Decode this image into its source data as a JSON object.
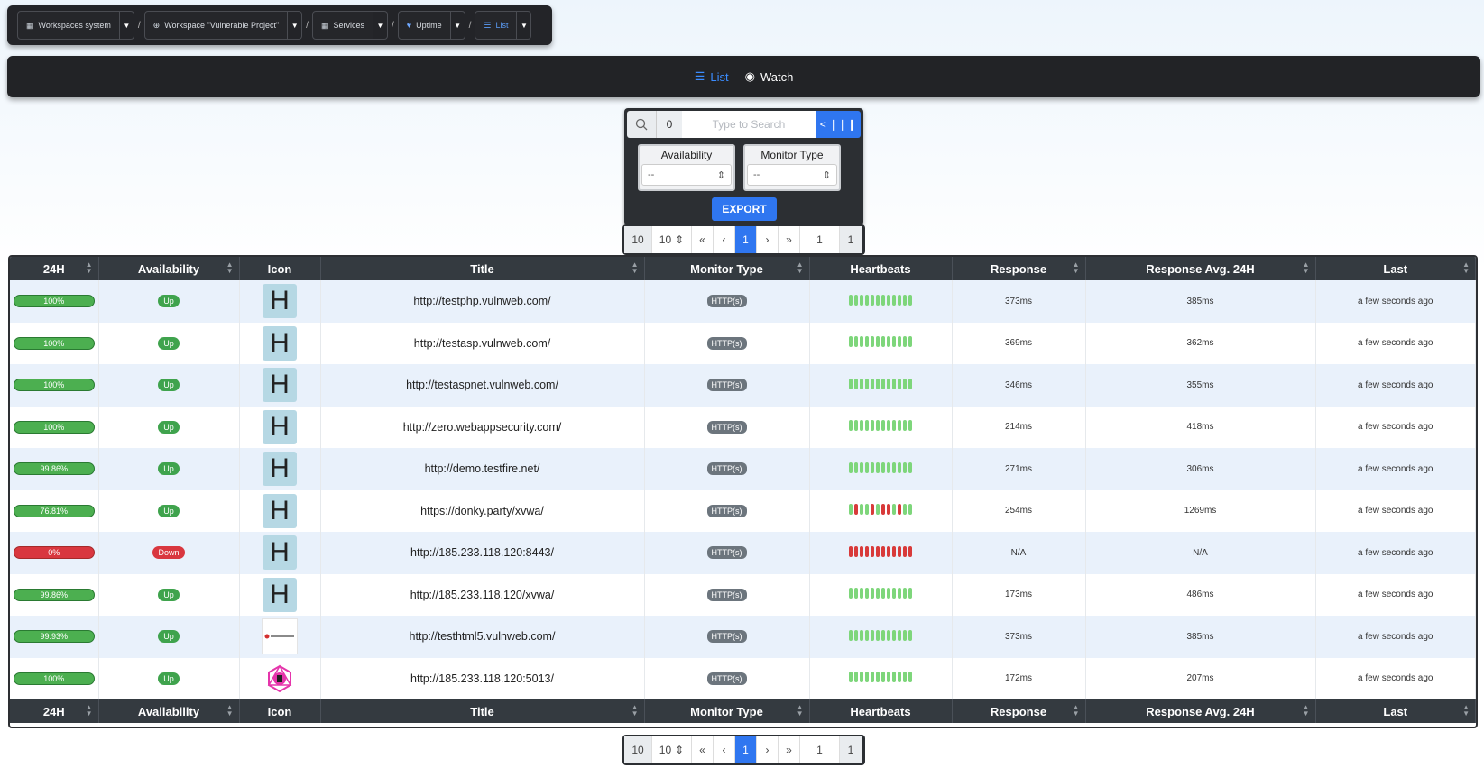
{
  "breadcrumb": {
    "items": [
      {
        "label": "Workspaces system",
        "icon": "grid-icon"
      },
      {
        "label": "Workspace \"Vulnerable Project\"",
        "icon": "circle-arrow-icon"
      },
      {
        "label": "Services",
        "icon": "grid-icon"
      },
      {
        "label": "Uptime",
        "icon": "heart-icon"
      },
      {
        "label": "List",
        "icon": "list-icon"
      }
    ],
    "separator": "/"
  },
  "tabs": [
    {
      "label": "List",
      "active": true
    },
    {
      "label": "Watch",
      "active": false
    }
  ],
  "search": {
    "count": "0",
    "placeholder": "Type to Search",
    "toggle_label": "< ❙❙❙"
  },
  "filters": {
    "availability": {
      "label": "Availability",
      "value": "--"
    },
    "monitor_type": {
      "label": "Monitor Type",
      "value": "--"
    }
  },
  "export_label": "EXPORT",
  "pagination": {
    "page_size_label": "10",
    "page_size_value": "10",
    "first": "«",
    "prev": "‹",
    "current": "1",
    "next": "›",
    "last": "»",
    "goto_value": "1",
    "total_pages": "1"
  },
  "table": {
    "headers": [
      "24H",
      "Availability",
      "Icon",
      "Title",
      "Monitor Type",
      "Heartbeats",
      "Response",
      "Response Avg. 24H",
      "Last"
    ],
    "rows": [
      {
        "h24": "100%",
        "h24_status": "ok",
        "availability": "Up",
        "icon": "H",
        "title": "http://testphp.vulnweb.com/",
        "type": "HTTP(s)",
        "beats": "gggggggggggg",
        "response": "373ms",
        "avg": "385ms",
        "last": "a few seconds ago"
      },
      {
        "h24": "100%",
        "h24_status": "ok",
        "availability": "Up",
        "icon": "H",
        "title": "http://testasp.vulnweb.com/",
        "type": "HTTP(s)",
        "beats": "gggggggggggg",
        "response": "369ms",
        "avg": "362ms",
        "last": "a few seconds ago"
      },
      {
        "h24": "100%",
        "h24_status": "ok",
        "availability": "Up",
        "icon": "H",
        "title": "http://testaspnet.vulnweb.com/",
        "type": "HTTP(s)",
        "beats": "gggggggggggg",
        "response": "346ms",
        "avg": "355ms",
        "last": "a few seconds ago"
      },
      {
        "h24": "100%",
        "h24_status": "ok",
        "availability": "Up",
        "icon": "H",
        "title": "http://zero.webappsecurity.com/",
        "type": "HTTP(s)",
        "beats": "gggggggggggg",
        "response": "214ms",
        "avg": "418ms",
        "last": "a few seconds ago"
      },
      {
        "h24": "99.86%",
        "h24_status": "ok",
        "availability": "Up",
        "icon": "H",
        "title": "http://demo.testfire.net/",
        "type": "HTTP(s)",
        "beats": "gggggggggggg",
        "response": "271ms",
        "avg": "306ms",
        "last": "a few seconds ago"
      },
      {
        "h24": "76.81%",
        "h24_status": "ok",
        "availability": "Up",
        "icon": "H",
        "title": "https://donky.party/xvwa/",
        "type": "HTTP(s)",
        "beats": "grggrgrrgrgg",
        "response": "254ms",
        "avg": "1269ms",
        "last": "a few seconds ago"
      },
      {
        "h24": "0%",
        "h24_status": "bad",
        "availability": "Down",
        "icon": "H",
        "title": "http://185.233.118.120:8443/",
        "type": "HTTP(s)",
        "beats": "rrrrrrrrrrrr",
        "response": "N/A",
        "avg": "N/A",
        "last": "a few seconds ago"
      },
      {
        "h24": "99.86%",
        "h24_status": "ok",
        "availability": "Up",
        "icon": "H",
        "title": "http://185.233.118.120/xvwa/",
        "type": "HTTP(s)",
        "beats": "gggggggggggg",
        "response": "173ms",
        "avg": "486ms",
        "last": "a few seconds ago"
      },
      {
        "h24": "99.93%",
        "h24_status": "ok",
        "availability": "Up",
        "icon": "securitytweets-logo",
        "title": "http://testhtml5.vulnweb.com/",
        "type": "HTTP(s)",
        "beats": "gggggggggggg",
        "response": "373ms",
        "avg": "385ms",
        "last": "a few seconds ago"
      },
      {
        "h24": "100%",
        "h24_status": "ok",
        "availability": "Up",
        "icon": "graphql-logo",
        "title": "http://185.233.118.120:5013/",
        "type": "HTTP(s)",
        "beats": "gggggggggggg",
        "response": "172ms",
        "avg": "207ms",
        "last": "a few seconds ago"
      }
    ]
  },
  "colors": {
    "accent": "#2f76f0",
    "up": "#3fa34d",
    "down": "#d9373f",
    "beat_ok": "#7ed67b",
    "beat_bad": "#d83a3a",
    "header": "#343a40"
  }
}
